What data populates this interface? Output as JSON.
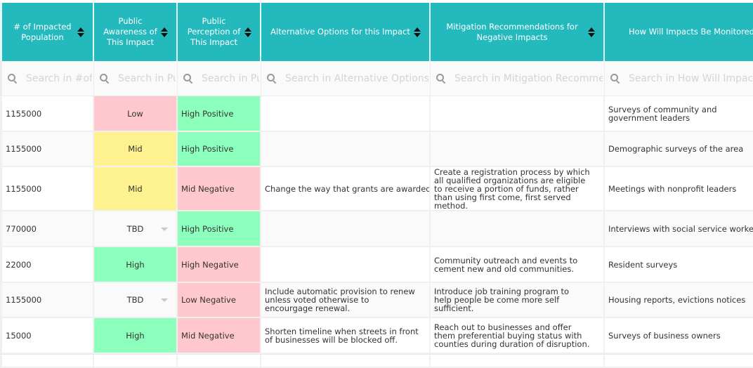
{
  "columns": [
    {
      "key": "population",
      "label": "# of Impacted Population",
      "search_placeholder": "Search in #of Impacted Population"
    },
    {
      "key": "awareness",
      "label": "Public Awareness of This Impact",
      "search_placeholder": "Search in Public Awareness of This Impact"
    },
    {
      "key": "perception",
      "label": "Public Perception of This Impact",
      "search_placeholder": "Search in Public Perception of This Impact"
    },
    {
      "key": "alternatives",
      "label": "Alternative Options for this Impact",
      "search_placeholder": "Search in Alternative Options for this Impact"
    },
    {
      "key": "mitigation",
      "label": "Mitigation Recommendations for Negative Impacts",
      "search_placeholder": "Search in Mitigation Recommendations for Negative Impacts"
    },
    {
      "key": "monitoring",
      "label": "How Will Impacts Be Monitored?",
      "search_placeholder": "Search in How Will Impacts Be Monitored?"
    }
  ],
  "rows": [
    {
      "population": "1155000",
      "awareness": "Low",
      "perception": "High Positive",
      "alternatives": "",
      "mitigation": "",
      "monitoring": "Surveys of community and government leaders"
    },
    {
      "population": "1155000",
      "awareness": "Mid",
      "perception": "High Positive",
      "alternatives": "",
      "mitigation": "",
      "monitoring": "Demographic surveys of the area"
    },
    {
      "population": "1155000",
      "awareness": "Mid",
      "perception": "Mid Negative",
      "alternatives": "Change the way that grants are awarded",
      "mitigation": "Create a registration process by which all qualified organizations are eligible to receive a portion of funds, rather than using first come, first served method.",
      "monitoring": "Meetings with nonprofit leaders"
    },
    {
      "population": "770000",
      "awareness": "TBD",
      "perception": "High Positive",
      "alternatives": "",
      "mitigation": "",
      "monitoring": "Interviews with social service workers"
    },
    {
      "population": "22000",
      "awareness": "High",
      "perception": "High Negative",
      "alternatives": "",
      "mitigation": "Community outreach and events to cement new and old communities.",
      "monitoring": "Resident surveys"
    },
    {
      "population": "1155000",
      "awareness": "TBD",
      "perception": "Low Negative",
      "alternatives": "Include automatic provision to renew unless voted otherwise to encourgage renewal.",
      "mitigation": "Introduce job training program to help people be come more self sufficient.",
      "monitoring": "Housing reports, evictions notices"
    },
    {
      "population": "15000",
      "awareness": "High",
      "perception": "Mid Negative",
      "alternatives": "Shorten timeline when streets in front of businesses will be blocked off.",
      "mitigation": "Reach out to businesses and offer them preferential buying status with counties during duration of disruption.",
      "monitoring": "Surveys of business owners"
    }
  ],
  "status_colors": {
    "red": "#ffc7ce",
    "yellow": "#fef190",
    "green": "#8dffbc",
    "header": "#24b9bd"
  }
}
